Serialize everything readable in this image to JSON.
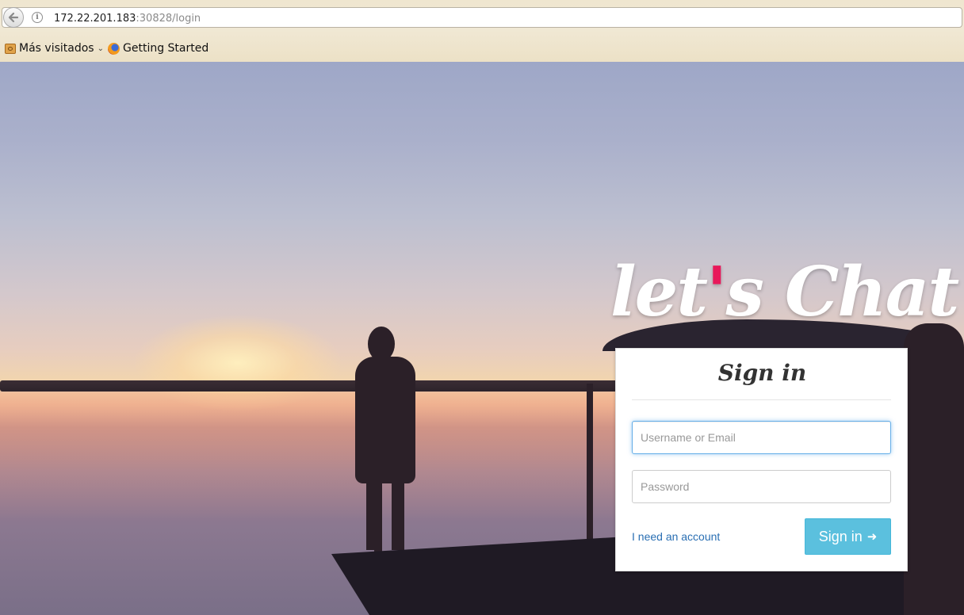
{
  "browser": {
    "url_host": "172.22.201.183",
    "url_rest": ":30828/login",
    "bookmarks": [
      {
        "label": "Más visitados"
      },
      {
        "label": "Getting Started"
      }
    ]
  },
  "app": {
    "logo_pre": "let",
    "logo_apostrophe": "'",
    "logo_post": "s Chat"
  },
  "login": {
    "title": "Sign in",
    "username_placeholder": "Username or Email",
    "password_placeholder": "Password",
    "need_account_label": "I need an account",
    "signin_label": "Sign in",
    "signin_icon": "sign-in-icon"
  },
  "colors": {
    "accent": "#5bc0de",
    "link": "#2a6fb3",
    "logo_accent": "#e8185a"
  }
}
